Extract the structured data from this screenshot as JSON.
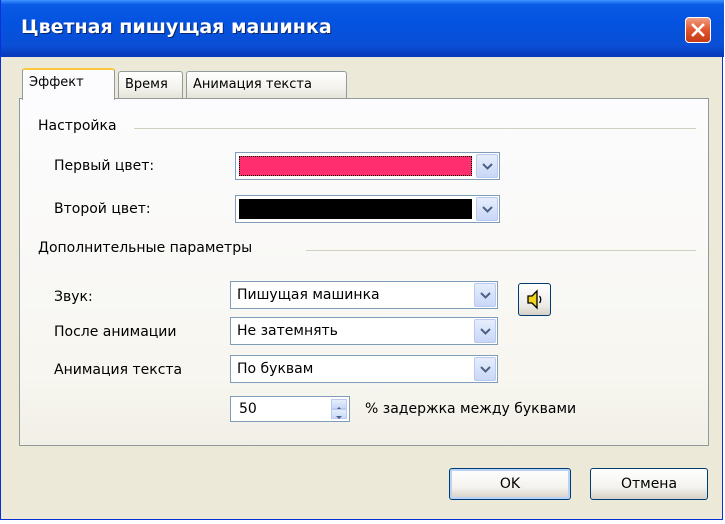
{
  "window": {
    "title": "Цветная пишущая машинка"
  },
  "tabs": [
    {
      "label": "Эффект",
      "active": true
    },
    {
      "label": "Время",
      "active": false
    },
    {
      "label": "Анимация текста",
      "active": false
    }
  ],
  "settings_group": {
    "title": "Настройка",
    "first_color_label": "Первый цвет:",
    "first_color_value": "#ff2e6e",
    "second_color_label": "Второй цвет:",
    "second_color_value": "#000000"
  },
  "advanced_group": {
    "title": "Дополнительные параметры",
    "sound_label": "Звук:",
    "sound_value": "Пишущая машинка",
    "after_animation_label": "После анимации",
    "after_animation_value": "Не затемнять",
    "animate_text_label": "Анимация текста",
    "animate_text_value": "По буквам",
    "delay_value": "50",
    "delay_label": "% задержка между буквами"
  },
  "buttons": {
    "ok": "OK",
    "cancel": "Отмена"
  },
  "icons": {
    "close": "close-icon",
    "sound": "speaker-icon",
    "dropdown": "chevron-down-icon"
  },
  "colors": {
    "titlebar": "#0a5ae6",
    "dialog_bg": "#ece9d8",
    "tab_highlight": "#ffc73c"
  }
}
